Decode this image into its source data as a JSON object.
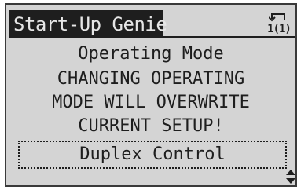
{
  "header": {
    "title": "Start-Up Genie",
    "menu_indicator": {
      "icon": "return-arrow-icon",
      "level": "1(1)"
    }
  },
  "parameter": {
    "name": "Operating Mode",
    "warning_lines": [
      "CHANGING OPERATING",
      "MODE WILL OVERWRITE",
      "CURRENT SETUP!"
    ],
    "value": "Duplex Control"
  },
  "scroll_indicator": {
    "icon": "up-down-scroll-icon"
  },
  "colors": {
    "screen_background": "#d4d4d4",
    "foreground": "#1e1e1e",
    "title_text": "#e6e6e6"
  }
}
